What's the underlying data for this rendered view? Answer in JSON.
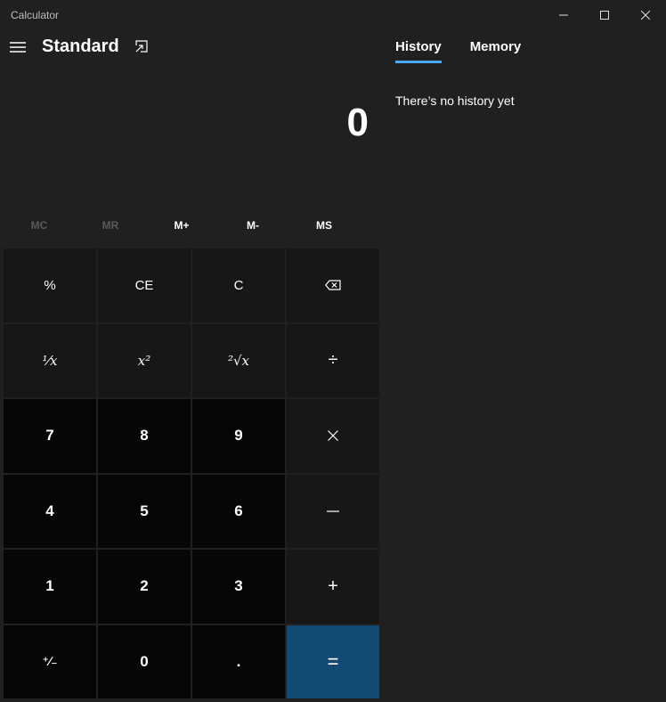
{
  "window": {
    "title": "Calculator"
  },
  "header": {
    "mode": "Standard"
  },
  "display": {
    "value": "0"
  },
  "memory": [
    {
      "label": "MC",
      "enabled": false
    },
    {
      "label": "MR",
      "enabled": false
    },
    {
      "label": "M+",
      "enabled": true
    },
    {
      "label": "M-",
      "enabled": true
    },
    {
      "label": "MS",
      "enabled": true
    }
  ],
  "keys": {
    "percent": "%",
    "ce": "CE",
    "c": "C",
    "reciprocal": "⅟x",
    "square": "x²",
    "sqrt": "²√x",
    "divide": "÷",
    "seven": "7",
    "eight": "8",
    "nine": "9",
    "four": "4",
    "five": "5",
    "six": "6",
    "one": "1",
    "two": "2",
    "three": "3",
    "plus": "+",
    "negate": "⁺∕₋",
    "zero": "0",
    "decimal": ".",
    "equals": "="
  },
  "icons": {
    "menu": "hamburger-menu-icon",
    "keep_on_top": "keep-on-top-icon",
    "backspace": "backspace-icon",
    "multiply": "multiply-icon",
    "minus": "minus-icon"
  },
  "side_panel": {
    "tabs": [
      {
        "label": "History",
        "active": true
      },
      {
        "label": "Memory",
        "active": false
      }
    ],
    "history_empty": "There’s no history yet"
  },
  "colors": {
    "background": "#202020",
    "key": "#171717",
    "number_key": "#060606",
    "equals": "#134a73",
    "accent": "#4aa8ff"
  }
}
